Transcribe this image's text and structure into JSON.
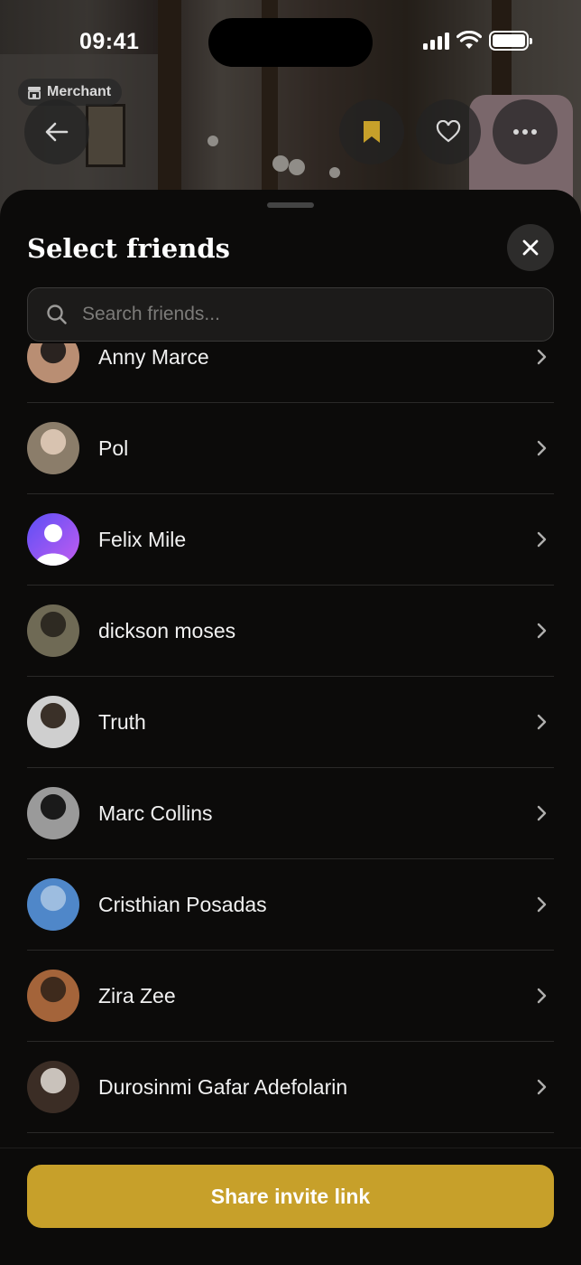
{
  "status_bar": {
    "time": "09:41"
  },
  "header": {
    "merchant_label": "Merchant",
    "icons": [
      "back-arrow-icon",
      "bookmark-icon",
      "heart-icon",
      "more-icon"
    ],
    "accent": "#c7a02a"
  },
  "sheet": {
    "title": "Select friends",
    "search_placeholder": "Search friends...",
    "search_value": ""
  },
  "friends": [
    {
      "name": "Anny Marce",
      "avatar_colors": [
        "#b98e73",
        "#2a2320"
      ]
    },
    {
      "name": "Pol",
      "avatar_colors": [
        "#8b7d6a",
        "#d8c3b0"
      ]
    },
    {
      "name": "Felix Mile",
      "avatar_colors": [
        "#5b4ff6",
        "#c35cf0"
      ]
    },
    {
      "name": "dickson moses",
      "avatar_colors": [
        "#6f6a55",
        "#2e2a22"
      ]
    },
    {
      "name": "Truth",
      "avatar_colors": [
        "#cfcfcf",
        "#3a3028"
      ]
    },
    {
      "name": "Marc Collins",
      "avatar_colors": [
        "#9a9a9a",
        "#1a1a1a"
      ]
    },
    {
      "name": "Cristhian Posadas",
      "avatar_colors": [
        "#4f87c9",
        "#9dbde0"
      ]
    },
    {
      "name": "Zira Zee",
      "avatar_colors": [
        "#a4643a",
        "#3e2a1c"
      ]
    },
    {
      "name": "Durosinmi Gafar Adefolarin",
      "avatar_colors": [
        "#3b2d25",
        "#c9c2bb"
      ]
    }
  ],
  "footer": {
    "share_label": "Share invite link"
  }
}
